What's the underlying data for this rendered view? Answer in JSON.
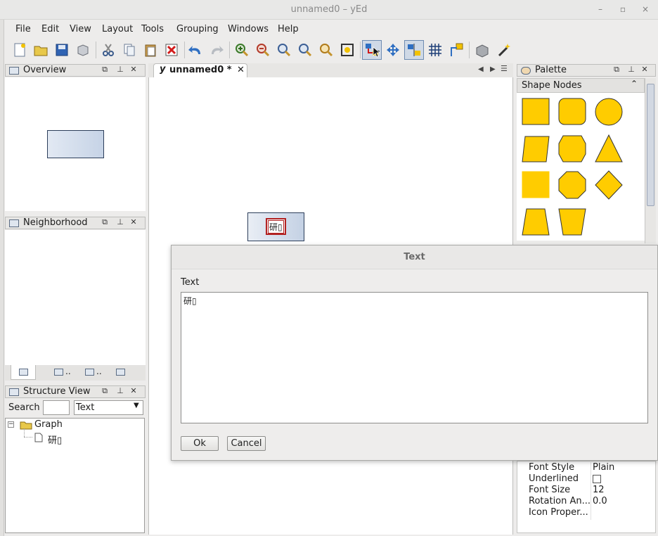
{
  "window": {
    "title": "unnamed0 – yEd",
    "minimize_icon": "–",
    "maximize_icon": "▫",
    "close_icon": "×"
  },
  "menu": [
    "File",
    "Edit",
    "View",
    "Layout",
    "Tools",
    "Grouping",
    "Windows",
    "Help"
  ],
  "panels": {
    "overview": "Overview",
    "neighborhood": "Neighborhood",
    "structure": "Structure View",
    "palette": "Palette"
  },
  "structure": {
    "search_label": "Search",
    "search_value": "",
    "filter_value": "Text",
    "tree_root": "Graph",
    "tree_child": "研▯"
  },
  "bottom_tabs": [
    "",
    "..",
    "..",
    ""
  ],
  "document": {
    "tab_label": "unnamed0 *",
    "node_label": "研▯"
  },
  "palette": {
    "section": "Shape Nodes"
  },
  "dialog": {
    "title": "Text",
    "field_label": "Text",
    "text_value": "研▯",
    "ok": "Ok",
    "cancel": "Cancel"
  },
  "properties": [
    {
      "key": "Font Style",
      "value": "Plain"
    },
    {
      "key": "Underlined",
      "value": ""
    },
    {
      "key": "Font Size",
      "value": "12"
    },
    {
      "key": "Rotation An...",
      "value": "0.0"
    },
    {
      "key": "Icon Proper...",
      "value": ""
    }
  ],
  "colors": {
    "node_fill": "#ffcc00",
    "selection": "#cfd9e6",
    "canvas": "#ffffff"
  }
}
